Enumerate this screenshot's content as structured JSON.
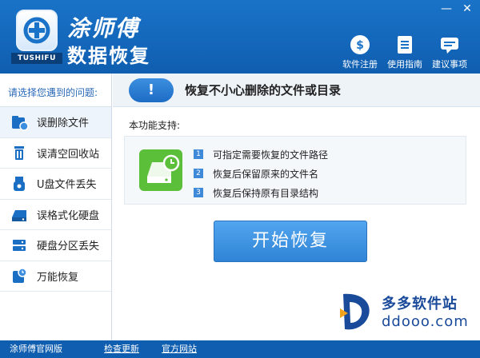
{
  "header": {
    "brand_line1": "涂师傅",
    "brand_line2": "数据恢复",
    "logo_sub": "TUSHIFU",
    "minimize_glyph": "—",
    "close_glyph": "✕",
    "tools": [
      {
        "label": "软件注册",
        "icon": "coin-register-icon"
      },
      {
        "label": "使用指南",
        "icon": "guide-book-icon"
      },
      {
        "label": "建议事项",
        "icon": "suggestion-chat-icon"
      }
    ]
  },
  "sidebar": {
    "title": "请选择您遇到的问题:",
    "items": [
      {
        "label": "误删除文件",
        "icon": "delete-file-icon"
      },
      {
        "label": "误清空回收站",
        "icon": "recycle-bin-icon"
      },
      {
        "label": "U盘文件丢失",
        "icon": "usb-drive-icon"
      },
      {
        "label": "误格式化硬盘",
        "icon": "format-disk-icon"
      },
      {
        "label": "硬盘分区丢失",
        "icon": "partition-icon"
      },
      {
        "label": "万能恢复",
        "icon": "universal-restore-icon"
      }
    ]
  },
  "main": {
    "banner_icon": "!",
    "banner_title": "恢复不小心删除的文件或目录",
    "support_label": "本功能支持:",
    "features": [
      {
        "num": "1",
        "text": "可指定需要恢复的文件路径"
      },
      {
        "num": "2",
        "text": "恢复后保留原来的文件名"
      },
      {
        "num": "3",
        "text": "恢复后保持原有目录结构"
      }
    ],
    "start_button": "开始恢复"
  },
  "watermark": {
    "name": "多多软件站",
    "url": "ddooo.com"
  },
  "footer": {
    "official_site": "涂师傅官网版",
    "check_update": "检查更新",
    "official_forum": "官方网站"
  },
  "colors": {
    "header_blue": "#1a73c8",
    "accent_blue": "#2f84d6",
    "drive_green": "#5bbf3a"
  }
}
